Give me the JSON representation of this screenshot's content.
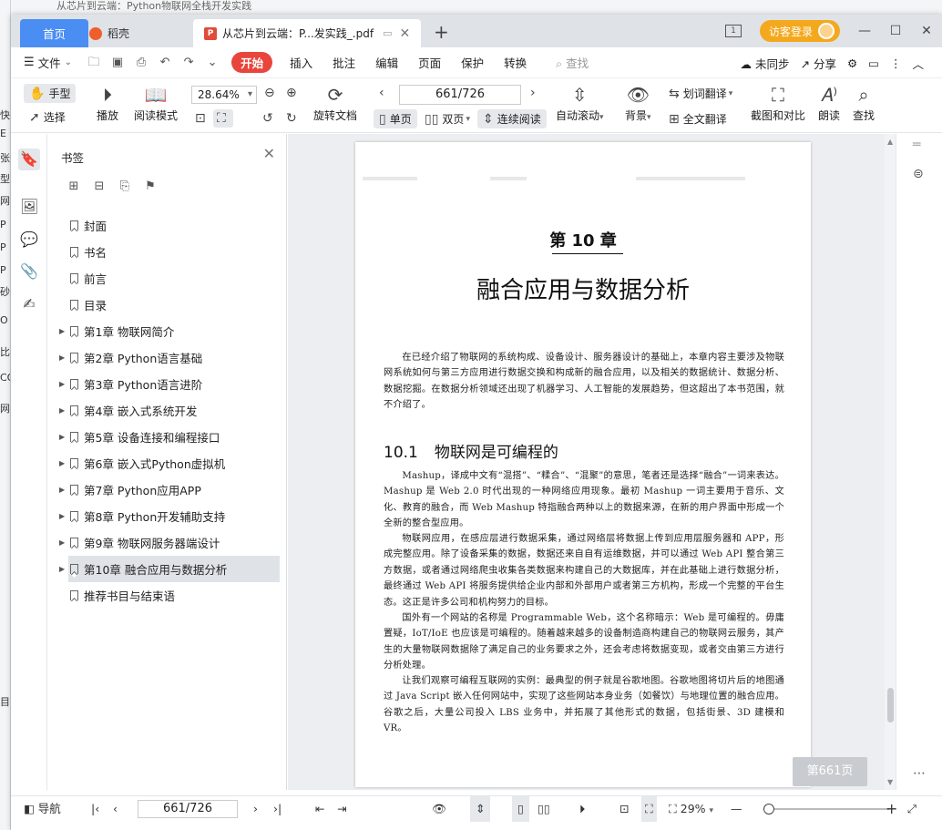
{
  "background_window": {
    "title_fragment": "从芯片到云端：Python物联网全栈开发实践",
    "left_fragments": [
      "快",
      "E",
      "张",
      "型",
      "网",
      "P",
      "P",
      "P",
      "砂",
      "O",
      "比",
      "CO",
      "网",
      "目"
    ]
  },
  "tabs": [
    {
      "label": "首页"
    },
    {
      "label": "稻壳"
    },
    {
      "label": "从芯片到云端：P...发实践_.pdf"
    }
  ],
  "guest_login": "访客登录",
  "menu": {
    "file": "文件",
    "start": "开始",
    "items": [
      "插入",
      "批注",
      "编辑",
      "页面",
      "保护",
      "转换"
    ],
    "search": "查找",
    "unsync": "未同步",
    "share": "分享"
  },
  "toolbar": {
    "hand": "手型",
    "select": "选择",
    "play": "播放",
    "read_mode": "阅读模式",
    "zoom": "28.64%",
    "rotate": "旋转文档",
    "page_display": "661/726",
    "single": "单页",
    "double": "双页",
    "continuous": "连续阅读",
    "autoscroll": "自动滚动",
    "background": "背景",
    "word_translate": "划词翻译",
    "full_translate": "全文翻译",
    "screenshot": "截图和对比",
    "read_aloud": "朗读",
    "find": "查找"
  },
  "bookmarks": {
    "title": "书签",
    "items": [
      {
        "label": "封面",
        "expandable": false
      },
      {
        "label": "书名",
        "expandable": false
      },
      {
        "label": "前言",
        "expandable": false
      },
      {
        "label": "目录",
        "expandable": false
      },
      {
        "label": "第1章 物联网简介",
        "expandable": true
      },
      {
        "label": "第2章 Python语言基础",
        "expandable": true
      },
      {
        "label": "第3章 Python语言进阶",
        "expandable": true
      },
      {
        "label": "第4章 嵌入式系统开发",
        "expandable": true
      },
      {
        "label": "第5章 设备连接和编程接口",
        "expandable": true
      },
      {
        "label": "第6章 嵌入式Python虚拟机",
        "expandable": true
      },
      {
        "label": "第7章 Python应用APP",
        "expandable": true
      },
      {
        "label": "第8章 Python开发辅助支持",
        "expandable": true
      },
      {
        "label": "第9章 物联网服务器端设计",
        "expandable": true
      },
      {
        "label": "第10章 融合应用与数据分析",
        "expandable": true,
        "selected": true
      },
      {
        "label": "推荐书目与结束语",
        "expandable": false
      }
    ]
  },
  "document": {
    "chapter_num": "第 10 章",
    "chapter_title": "融合应用与数据分析",
    "intro": "在已经介绍了物联网的系统构成、设备设计、服务器设计的基础上，本章内容主要涉及物联网系统如何与第三方应用进行数据交换和构成新的融合应用，以及相关的数据统计、数据分析、数据挖掘。在数据分析领域还出现了机器学习、人工智能的发展趋势，但这超出了本书范围，就不介绍了。",
    "section_num": "10.1",
    "section_title": "物联网是可编程的",
    "paragraphs": [
      "Mashup，译成中文有“混搭”、“糅合”、“混聚”的意思，笔者还是选择“融合”一词来表达。Mashup 是 Web 2.0 时代出现的一种网络应用现象。最初 Mashup 一词主要用于音乐、文化、教育的融合，而 Web Mashup 特指融合两种以上的数据来源，在新的用户界面中形成一个全新的整合型应用。",
      "物联网应用，在感应层进行数据采集，通过网络层将数据上传到应用层服务器和 APP，形成完整应用。除了设备采集的数据，数据还来自自有运维数据，并可以通过 Web API 整合第三方数据，或者通过网络爬虫收集各类数据来构建自己的大数据库，并在此基础上进行数据分析，最终通过 Web API 将服务提供给企业内部和外部用户或者第三方机构，形成一个完整的平台生态。这正是许多公司和机构努力的目标。",
      "国外有一个网站的名称是 Programmable Web，这个名称暗示：Web 是可编程的。毋庸置疑，IoT/IoE 也应该是可编程的。随着越来越多的设备制造商构建自己的物联网云服务，其产生的大量物联网数据除了满足自己的业务要求之外，还会考虑将数据变现，或者交由第三方进行分析处理。",
      "让我们观察可编程互联网的实例：最典型的例子就是谷歌地图。谷歌地图将切片后的地图通过 Java Script 嵌入任何网站中，实现了这些网站本身业务（如餐饮）与地理位置的融合应用。谷歌之后，大量公司投入 LBS 业务中，并拓展了其他形式的数据，包括街景、3D 建模和 VR。"
    ],
    "page_badge": "第661页"
  },
  "statusbar": {
    "nav": "导航",
    "page": "661/726",
    "zoom": "29%"
  },
  "colors": {
    "home_tab": "#4a8ef3",
    "start_button": "#e8453c",
    "guest_button": "#f4a81d",
    "selected_bookmark": "#dfe3e8"
  }
}
